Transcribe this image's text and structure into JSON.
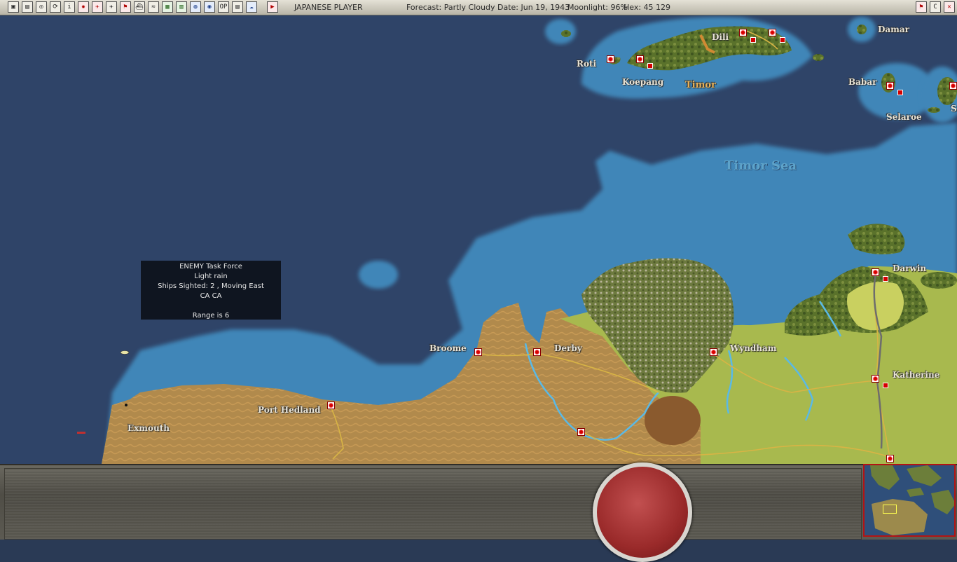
{
  "toolbar": {
    "buttons": [
      {
        "name": "save-game-button",
        "glyph": "▣"
      },
      {
        "name": "reports-button",
        "glyph": "▤"
      },
      {
        "name": "toggle-view-button",
        "glyph": "◎"
      },
      {
        "name": "sync-button",
        "glyph": "⟳"
      },
      {
        "name": "info-button",
        "glyph": "i"
      },
      {
        "name": "japan-flag-button",
        "glyph": "✹"
      },
      {
        "name": "air-units-button",
        "glyph": "✈"
      },
      {
        "name": "aircraft-button",
        "glyph": "✈"
      },
      {
        "name": "flag-button",
        "glyph": "⚑"
      },
      {
        "name": "ship-button",
        "glyph": "⛴"
      },
      {
        "name": "convoy-button",
        "glyph": "≈"
      },
      {
        "name": "terrain-button",
        "glyph": "▦"
      },
      {
        "name": "factory-button",
        "glyph": "▥"
      },
      {
        "name": "globe-button",
        "glyph": "◍"
      },
      {
        "name": "target-button",
        "glyph": "◉"
      },
      {
        "name": "op-button",
        "glyph": "OP"
      },
      {
        "name": "table-button",
        "glyph": "▤"
      },
      {
        "name": "weather-button",
        "glyph": "☁"
      }
    ],
    "end_turn_glyph": "▶",
    "right_buttons": [
      {
        "name": "map-filter-button",
        "glyph": "⚑"
      },
      {
        "name": "c-button",
        "glyph": "C"
      },
      {
        "name": "close-button",
        "glyph": "✕"
      }
    ]
  },
  "status": {
    "player": "JAPANESE PLAYER",
    "forecast": "Forecast: Partly Cloudy",
    "date": "Date: Jun 19, 1943",
    "moonlight": "Moonlight: 96%",
    "hex": "Hex: 45 129"
  },
  "places": {
    "damar": "Damar",
    "dili": "Dili",
    "roti": "Roti",
    "koepang": "Koepang",
    "timor": "Timor",
    "babar": "Babar",
    "selaroe": "Selaroe",
    "s_edge": "S",
    "timor_sea": "Timor Sea",
    "darwin": "Darwin",
    "broome": "Broome",
    "derby": "Derby",
    "wyndham": "Wyndham",
    "katherine": "Katherine",
    "port_hedland": "Port Hedland",
    "exmouth": "Exmouth"
  },
  "tooltip": {
    "line1": "ENEMY Task Force",
    "line2": "Light rain",
    "line3": "Ships Sighted: 2 , Moving East",
    "line4": "CA CA",
    "line5": "",
    "line6": "Range is 6"
  },
  "colors": {
    "deep_sea": "#2f4468",
    "shallow_sea": "#3f86b8",
    "desert": "#b18a4c",
    "grassland": "#a8b94e",
    "jungle": "#5f7a2c",
    "base_red": "#d40000"
  }
}
